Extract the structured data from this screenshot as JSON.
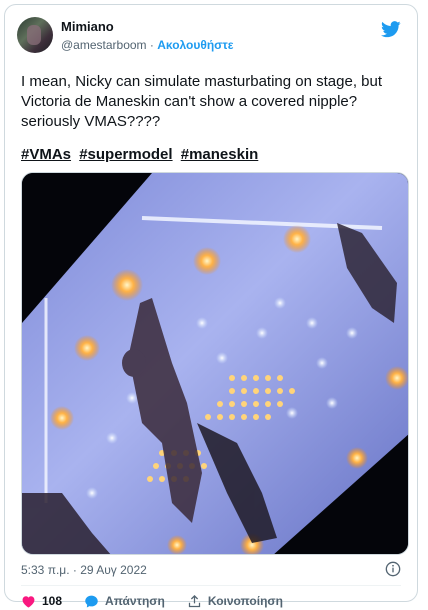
{
  "author": {
    "name": "Mimiano",
    "handle": "@amestarboom",
    "separator": "·",
    "follow_label": "Ακολουθήστε"
  },
  "tweet": {
    "text": "I mean, Nicky can simulate masturbating on stage, but Victoria de Maneskin can't show a covered nipple? seriously VMAS????",
    "hashtags": [
      "#VMAs",
      "#supermodel",
      "#maneskin"
    ]
  },
  "meta": {
    "timestamp": "5:33 π.μ. · 29 Αυγ 2022"
  },
  "actions": {
    "like_count": "108",
    "reply_label": "Απάντηση",
    "share_label": "Κοινοποίηση"
  },
  "colors": {
    "accent": "#1d9bf0",
    "like": "#f91880",
    "muted": "#536471"
  },
  "icons": {
    "brand": "twitter-bird-icon",
    "info": "info-icon",
    "like": "heart-icon",
    "reply": "speech-bubble-icon",
    "share": "share-upload-icon"
  }
}
